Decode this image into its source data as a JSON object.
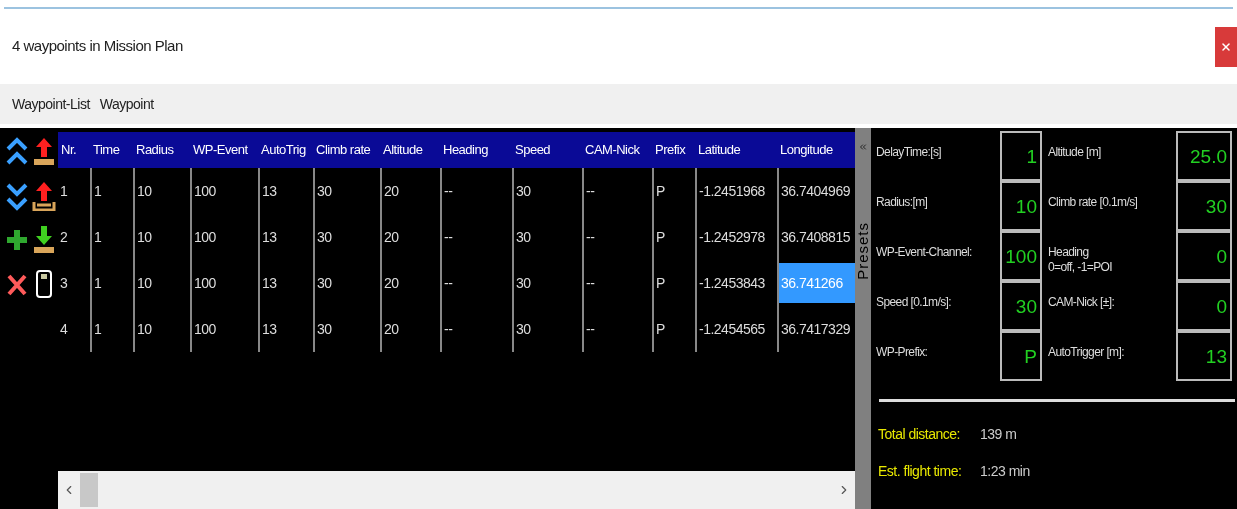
{
  "window": {
    "title": "4 waypoints in Mission Plan"
  },
  "menu": [
    {
      "label": "Waypoint-List"
    },
    {
      "label": "Waypoint"
    }
  ],
  "toolbar": [
    {
      "kind": "double-up"
    },
    {
      "kind": "upload-tray"
    },
    {
      "kind": "double-down"
    },
    {
      "kind": "upload-bracket"
    },
    {
      "kind": "add"
    },
    {
      "kind": "download-tray"
    },
    {
      "kind": "delete"
    },
    {
      "kind": "card"
    }
  ],
  "table": {
    "columns": [
      "Nr.",
      "Time",
      "Radius",
      "WP-Event",
      "AutoTrig",
      "Climb rate",
      "Altitude",
      "Heading",
      "Speed",
      "CAM-Nick",
      "Prefix",
      "Latitude",
      "Longitude"
    ],
    "rows": [
      {
        "cells": [
          {
            "text": "1",
            "selected": false
          },
          {
            "text": "1",
            "selected": false
          },
          {
            "text": "10",
            "selected": false
          },
          {
            "text": "100",
            "selected": false
          },
          {
            "text": "13",
            "selected": false
          },
          {
            "text": "30",
            "selected": false
          },
          {
            "text": "20",
            "selected": false
          },
          {
            "text": "--",
            "selected": false
          },
          {
            "text": "30",
            "selected": false
          },
          {
            "text": "--",
            "selected": false
          },
          {
            "text": "P",
            "selected": false
          },
          {
            "text": "-1.2451968",
            "selected": false
          },
          {
            "text": "36.7404969",
            "selected": false
          }
        ]
      },
      {
        "cells": [
          {
            "text": "2",
            "selected": false
          },
          {
            "text": "1",
            "selected": false
          },
          {
            "text": "10",
            "selected": false
          },
          {
            "text": "100",
            "selected": false
          },
          {
            "text": "13",
            "selected": false
          },
          {
            "text": "30",
            "selected": false
          },
          {
            "text": "20",
            "selected": false
          },
          {
            "text": "--",
            "selected": false
          },
          {
            "text": "30",
            "selected": false
          },
          {
            "text": "--",
            "selected": false
          },
          {
            "text": "P",
            "selected": false
          },
          {
            "text": "-1.2452978",
            "selected": false
          },
          {
            "text": "36.7408815",
            "selected": false
          }
        ]
      },
      {
        "cells": [
          {
            "text": "3",
            "selected": false
          },
          {
            "text": "1",
            "selected": false
          },
          {
            "text": "10",
            "selected": false
          },
          {
            "text": "100",
            "selected": false
          },
          {
            "text": "13",
            "selected": false
          },
          {
            "text": "30",
            "selected": false
          },
          {
            "text": "20",
            "selected": false
          },
          {
            "text": "--",
            "selected": false
          },
          {
            "text": "30",
            "selected": false
          },
          {
            "text": "--",
            "selected": false
          },
          {
            "text": "P",
            "selected": false
          },
          {
            "text": "-1.2453843",
            "selected": false
          },
          {
            "text": "36.741266",
            "selected": true
          }
        ]
      },
      {
        "cells": [
          {
            "text": "4",
            "selected": false
          },
          {
            "text": "1",
            "selected": false
          },
          {
            "text": "10",
            "selected": false
          },
          {
            "text": "100",
            "selected": false
          },
          {
            "text": "13",
            "selected": false
          },
          {
            "text": "30",
            "selected": false
          },
          {
            "text": "20",
            "selected": false
          },
          {
            "text": "--",
            "selected": false
          },
          {
            "text": "30",
            "selected": false
          },
          {
            "text": "--",
            "selected": false
          },
          {
            "text": "P",
            "selected": false
          },
          {
            "text": "-1.2454565",
            "selected": false
          },
          {
            "text": "36.7417329",
            "selected": false
          }
        ]
      }
    ]
  },
  "presets": {
    "tab": "Presets",
    "fields": [
      {
        "label": "DelayTime:[s]",
        "value": "1"
      },
      {
        "label": "Altitude [m]",
        "value": "25.0"
      },
      {
        "label": "Radius:[m]",
        "value": "10"
      },
      {
        "label": "Climb rate [0.1m/s]",
        "value": "30"
      },
      {
        "label": "WP-Event-Channel:",
        "value": "100"
      },
      {
        "label": "Heading\n0=off, -1=POI",
        "value": "0"
      },
      {
        "label": "Speed [0.1m/s]:",
        "value": "30"
      },
      {
        "label": "CAM-Nick [±]:",
        "value": "0"
      },
      {
        "label": "WP-Prefix:",
        "value": "P"
      },
      {
        "label": "AutoTrigger [m]:",
        "value": "13"
      }
    ],
    "summary": [
      {
        "label": "Total distance:",
        "value": "139 m"
      },
      {
        "label": "Est. flight time:",
        "value": "1:23 min"
      }
    ]
  }
}
